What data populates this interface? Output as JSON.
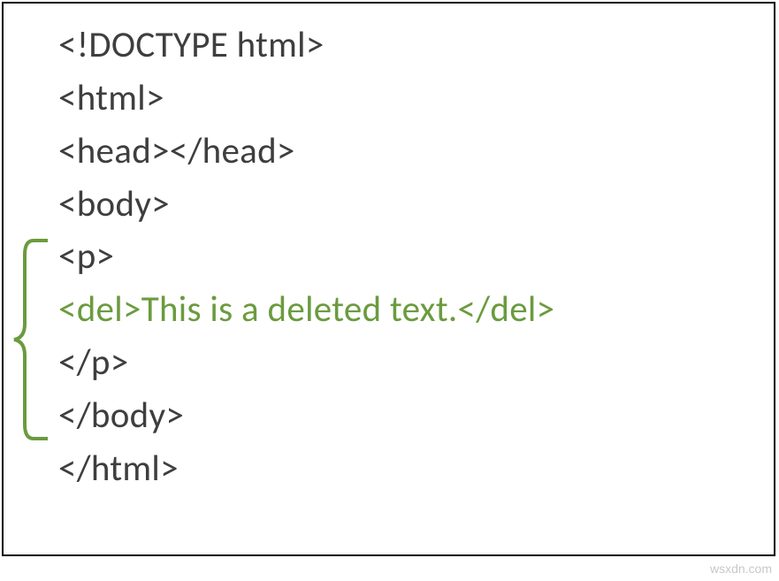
{
  "code": {
    "lines": [
      "<!DOCTYPE html>",
      "<html>",
      "<head></head>",
      "<body>",
      "<p>",
      "<del>This is a deleted text.</del>",
      "</p>",
      "</body>",
      "</html>"
    ],
    "highlight_index": 5
  },
  "watermark": "wsxdn.com"
}
